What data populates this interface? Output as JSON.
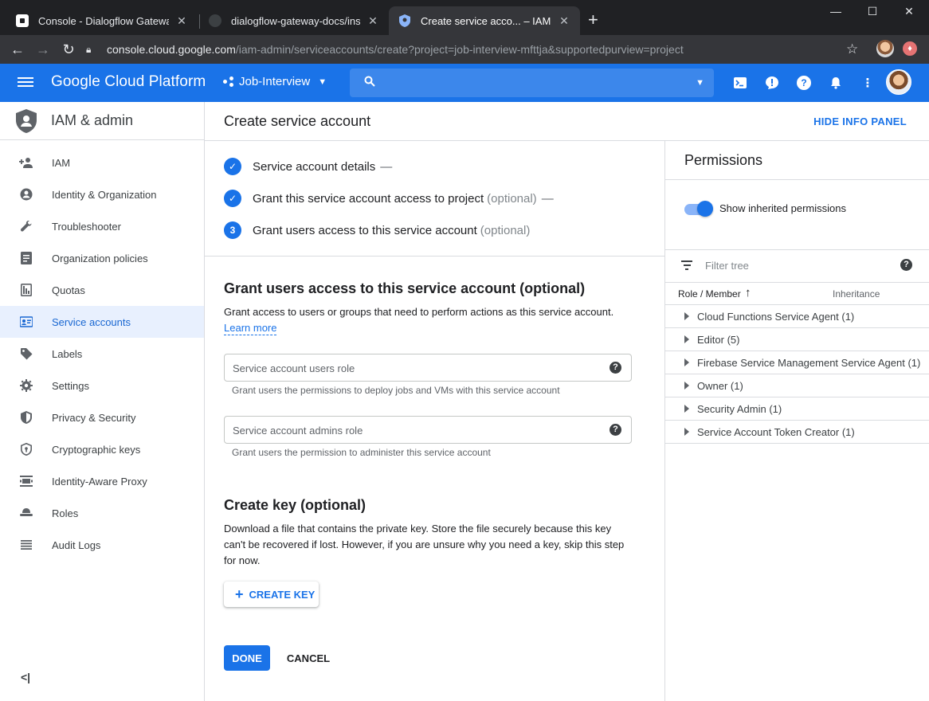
{
  "browser": {
    "tabs": [
      {
        "title": "Console - Dialogflow Gateway",
        "close": "✕"
      },
      {
        "title": "dialogflow-gateway-docs/installa",
        "close": "✕"
      },
      {
        "title": "Create service acco... – IAM & ad",
        "close": "✕"
      }
    ],
    "new_tab": "+",
    "url_host": "console.cloud.google.com",
    "url_path": "/iam-admin/serviceaccounts/create?project=job-interview-mfttja&supportedpurview=project"
  },
  "header": {
    "brand": "Google Cloud Platform",
    "project": "Job-Interview",
    "icons": [
      "cloud-shell-icon",
      "notifications-alert-icon",
      "help-icon",
      "bell-icon",
      "more-vert-icon",
      "account-avatar"
    ]
  },
  "sidebar": {
    "title": "IAM & admin",
    "items": [
      {
        "label": "IAM",
        "icon": "person-add-icon"
      },
      {
        "label": "Identity & Organization",
        "icon": "account-circle-icon"
      },
      {
        "label": "Troubleshooter",
        "icon": "wrench-icon"
      },
      {
        "label": "Organization policies",
        "icon": "document-icon"
      },
      {
        "label": "Quotas",
        "icon": "quota-icon"
      },
      {
        "label": "Service accounts",
        "icon": "service-account-icon",
        "active": true
      },
      {
        "label": "Labels",
        "icon": "label-icon"
      },
      {
        "label": "Settings",
        "icon": "gear-icon"
      },
      {
        "label": "Privacy & Security",
        "icon": "shield-icon"
      },
      {
        "label": "Cryptographic keys",
        "icon": "security-shield-icon"
      },
      {
        "label": "Identity-Aware Proxy",
        "icon": "proxy-icon"
      },
      {
        "label": "Roles",
        "icon": "roles-hat-icon"
      },
      {
        "label": "Audit Logs",
        "icon": "list-icon"
      }
    ],
    "collapse": "<|"
  },
  "page": {
    "title": "Create service account",
    "hide_info_panel": "HIDE INFO PANEL"
  },
  "steps": [
    {
      "marker": "✓",
      "label": "Service account details",
      "optional": "",
      "dash": "—"
    },
    {
      "marker": "✓",
      "label": "Grant this service account access to project",
      "optional": "(optional)",
      "dash": "—"
    },
    {
      "marker": "3",
      "label": "Grant users access to this service account",
      "optional": "(optional)",
      "dash": ""
    }
  ],
  "grant_section": {
    "heading": "Grant users access to this service account (optional)",
    "description": "Grant access to users or groups that need to perform actions as this service account.",
    "learn_more": "Learn more",
    "users_role_placeholder": "Service account users role",
    "users_role_hint": "Grant users the permissions to deploy jobs and VMs with this service account",
    "admins_role_placeholder": "Service account admins role",
    "admins_role_hint": "Grant users the permission to administer this service account"
  },
  "key_section": {
    "heading": "Create key (optional)",
    "description": "Download a file that contains the private key. Store the file securely because this key can't be recovered if lost. However, if you are unsure why you need a key, skip this step for now.",
    "create_key": "CREATE KEY"
  },
  "actions": {
    "done": "DONE",
    "cancel": "CANCEL"
  },
  "permissions": {
    "title": "Permissions",
    "toggle_label": "Show inherited permissions",
    "toggle_on": true,
    "filter_placeholder": "Filter tree",
    "col_role": "Role / Member",
    "col_inheritance": "Inheritance",
    "rows": [
      "Cloud Functions Service Agent (1)",
      "Editor (5)",
      "Firebase Service Management Service Agent (1)",
      "Owner (1)",
      "Security Admin (1)",
      "Service Account Token Creator (1)"
    ]
  },
  "colors": {
    "accent": "#1a73e8",
    "active_nav_bg": "#e8f0fe",
    "chrome_dark": "#202124"
  }
}
